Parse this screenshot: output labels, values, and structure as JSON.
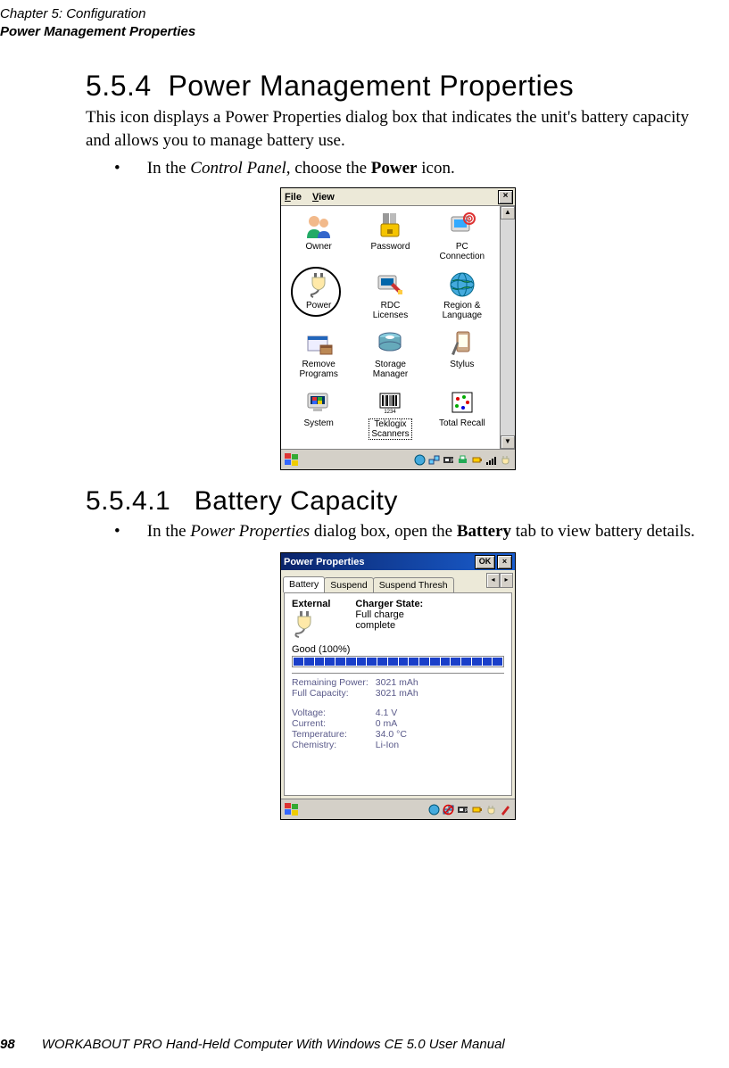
{
  "header": {
    "line1": "Chapter 5: Configuration",
    "line2": "Power Management Properties"
  },
  "sec554": {
    "num": "5.5.4",
    "title": "Power Management Properties",
    "body": "This icon displays a Power Properties dialog box that indicates the unit's battery capacity and allows you to manage battery use.",
    "bullet_pre": "In the ",
    "bullet_italic": "Control Panel",
    "bullet_mid": ", choose the ",
    "bullet_bold": "Power",
    "bullet_post": " icon."
  },
  "sec5541": {
    "num": "5.5.4.1",
    "title": "Battery Capacity",
    "bullet_pre": "In the ",
    "bullet_italic": "Power Properties",
    "bullet_mid": " dialog box, open the ",
    "bullet_bold": "Battery",
    "bullet_post": " tab to view battery details."
  },
  "cp": {
    "menu_file": "File",
    "menu_view": "View",
    "items": [
      {
        "label": "Owner"
      },
      {
        "label": "Password"
      },
      {
        "label": "PC\nConnection"
      },
      {
        "label": "Power"
      },
      {
        "label": "RDC\nLicenses"
      },
      {
        "label": "Region &\nLanguage"
      },
      {
        "label": "Remove\nPrograms"
      },
      {
        "label": "Storage\nManager"
      },
      {
        "label": "Stylus"
      },
      {
        "label": "System"
      },
      {
        "label": "Teklogix\nScanners"
      },
      {
        "label": "Total Recall"
      }
    ]
  },
  "pp": {
    "title": "Power Properties",
    "ok": "OK",
    "tabs": [
      "Battery",
      "Suspend",
      "Suspend Thresh"
    ],
    "external": "External",
    "charger_label": "Charger State:",
    "charger_state": "Full charge\ncomplete",
    "good": "Good  (100%)",
    "stats": {
      "remaining_power_label": "Remaining Power:",
      "remaining_power_value": "3021 mAh",
      "full_capacity_label": "Full Capacity:",
      "full_capacity_value": "3021 mAh",
      "voltage_label": "Voltage:",
      "voltage_value": "4.1 V",
      "current_label": "Current:",
      "current_value": "0 mA",
      "temperature_label": "Temperature:",
      "temperature_value": "34.0 °C",
      "chemistry_label": "Chemistry:",
      "chemistry_value": "Li-Ion"
    }
  },
  "footer": {
    "page": "98",
    "text": "WORKABOUT PRO Hand-Held Computer With Windows CE 5.0 User Manual"
  }
}
